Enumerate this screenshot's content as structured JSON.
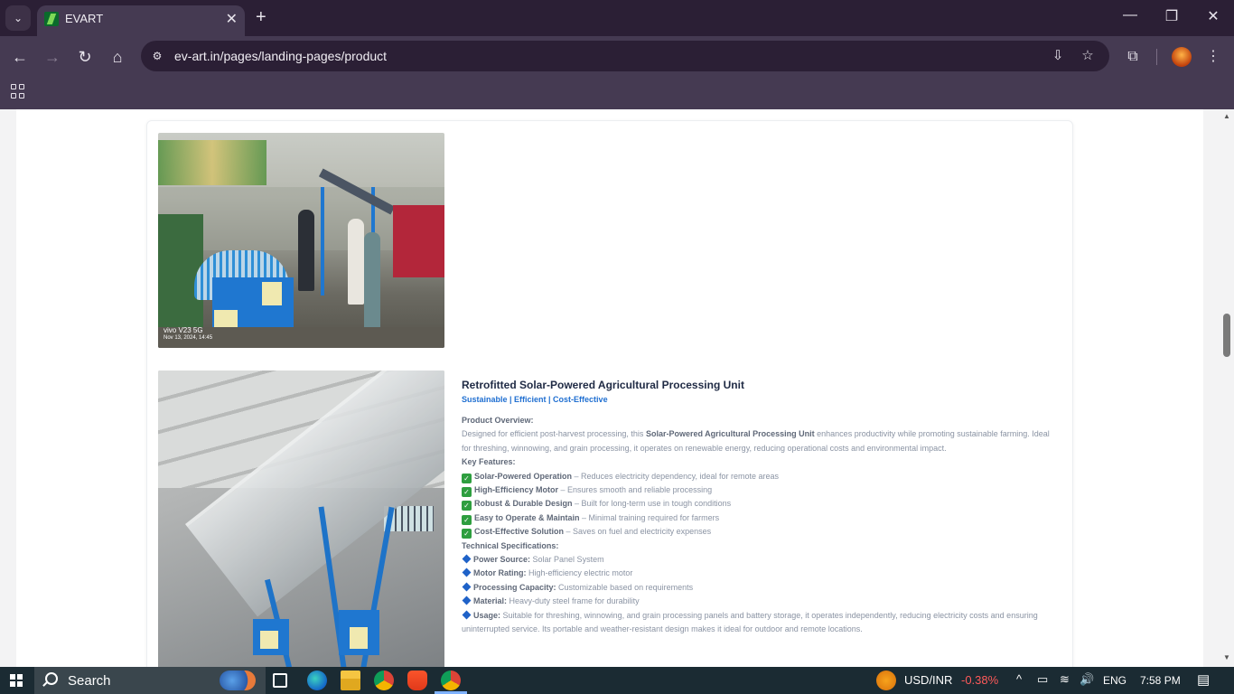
{
  "browser": {
    "tab_title": "EVART",
    "tab_close_glyph": "✕",
    "new_tab_glyph": "+",
    "tab_list_glyph": "⌄",
    "url": "ev-art.in/pages/landing-pages/product",
    "window_controls": {
      "minimize": "—",
      "restore": "❐",
      "close": "✕"
    },
    "nav": {
      "back": "←",
      "forward": "→",
      "reload": "↻",
      "home": "⌂"
    },
    "omni_icons": {
      "site_info": "⚙",
      "install": "⇩",
      "bookmark_star": "☆"
    },
    "toolbar_icons": {
      "extensions": "⧉",
      "menu": "⋮"
    }
  },
  "photos": [
    {
      "stamp_line1": "vivo V23 5G",
      "stamp_line2": "Nov 13, 2024, 14:45"
    },
    {}
  ],
  "product": {
    "title": "Retrofitted Solar-Powered Agricultural Processing Unit",
    "tagline": "Sustainable | Efficient | Cost-Effective",
    "overview_heading": "Product Overview:",
    "overview_pre": "Designed for efficient post-harvest processing, this ",
    "overview_bold": "Solar-Powered Agricultural Processing Unit",
    "overview_post": " enhances productivity while promoting sustainable farming. Ideal for threshing, winnowing, and grain processing, it operates on renewable energy, reducing operational costs and environmental impact.",
    "features_heading": "Key Features:",
    "features": [
      {
        "name": "Solar-Powered Operation",
        "desc": " – Reduces electricity dependency, ideal for remote areas"
      },
      {
        "name": "High-Efficiency Motor",
        "desc": " – Ensures smooth and reliable processing"
      },
      {
        "name": "Robust & Durable Design",
        "desc": " – Built for long-term use in tough conditions"
      },
      {
        "name": "Easy to Operate & Maintain",
        "desc": " – Minimal training required for farmers"
      },
      {
        "name": "Cost-Effective Solution",
        "desc": " – Saves on fuel and electricity expenses"
      }
    ],
    "specs_heading": "Technical Specifications:",
    "specs": [
      {
        "name": "Power Source:",
        "desc": " Solar Panel System"
      },
      {
        "name": "Motor Rating:",
        "desc": " High-efficiency electric motor"
      },
      {
        "name": "Processing Capacity:",
        "desc": " Customizable based on requirements"
      },
      {
        "name": "Material:",
        "desc": " Heavy-duty steel frame for durability"
      },
      {
        "name": "Usage:",
        "desc": " Suitable for threshing, winnowing, and grain processing panels and battery storage, it operates independently, reducing electricity costs and ensuring uninterrupted service. Its portable and weather-resistant design makes it ideal for outdoor and remote locations."
      }
    ],
    "check_glyph": "✓"
  },
  "scrollbar": {
    "up": "▲",
    "down": "▼",
    "position_fraction": 0.38
  },
  "taskbar": {
    "search_label": "Search",
    "ticker_label": "USD/INR",
    "ticker_value": "-0.38%",
    "language": "ENG",
    "time": "7:58 PM",
    "tray": {
      "chevron": "^",
      "battery": "▭",
      "wifi": "≋",
      "volume": "🔊",
      "notifications": "▤"
    },
    "apps": [
      "task-view",
      "edge",
      "file-explorer",
      "chrome",
      "brave",
      "chrome-active"
    ]
  },
  "colors": {
    "tab_strip": "#2b1f35",
    "toolbar": "#453a52",
    "accent_blue": "#1f6fd1",
    "ticker_negative": "#ff5a5a",
    "check_green": "#2e9e3f"
  }
}
